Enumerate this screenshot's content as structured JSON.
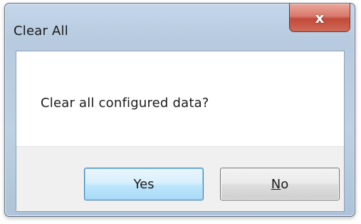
{
  "window": {
    "title": "Clear All",
    "close_glyph": "x"
  },
  "dialog": {
    "message": "Clear all configured data?"
  },
  "buttons": {
    "yes_label": "Yes",
    "no_mnemonic": "N",
    "no_rest": "o"
  },
  "icons": {
    "close": "close-icon"
  },
  "colors": {
    "close_button": "#c24a39",
    "default_button_border": "#3c7fb1",
    "titlebar": "#bed0e3"
  }
}
